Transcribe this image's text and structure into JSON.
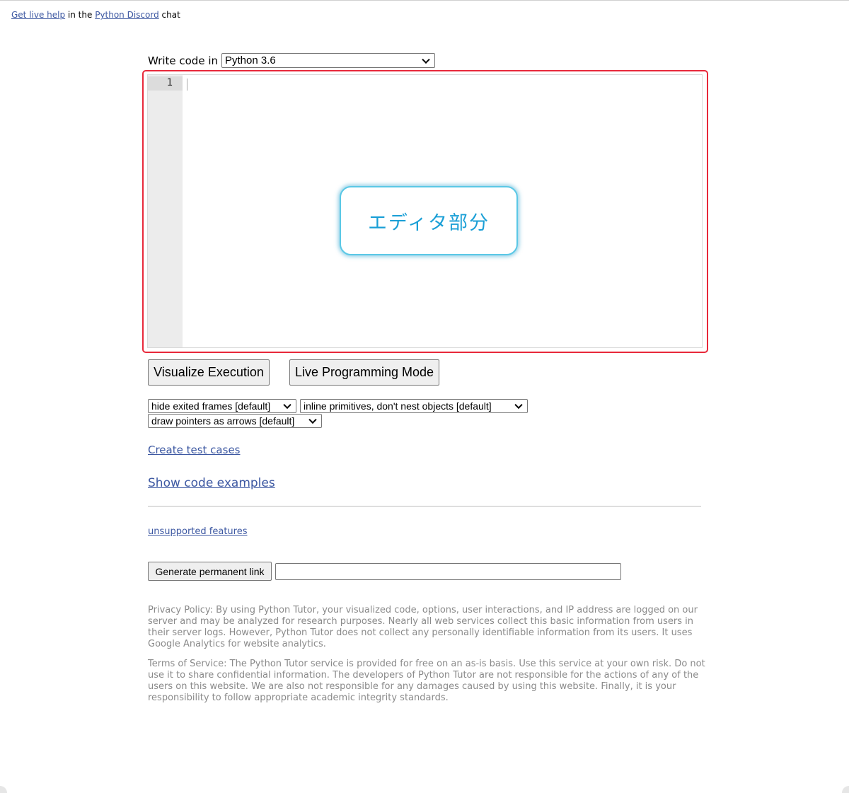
{
  "top_help": {
    "link1": "Get live help",
    "text1": " in the ",
    "link2": "Python Discord",
    "text2": " chat"
  },
  "editor_header": {
    "label": "Write code in",
    "language_selected": "Python 3.6"
  },
  "editor": {
    "line_numbers": [
      "1"
    ],
    "code": ""
  },
  "callout": {
    "text": "エディタ部分",
    "color": "#1a9fd6",
    "border_color": "#5bc8e6"
  },
  "highlight_color": "#e8283a",
  "buttons": {
    "visualize": "Visualize Execution",
    "live_mode": "Live Programming Mode",
    "permalink": "Generate permanent link"
  },
  "options": {
    "frames": "hide exited frames [default]",
    "primitives": "inline primitives, don't nest objects [default]",
    "pointers": "draw pointers as arrows [default]"
  },
  "links": {
    "test_cases": "Create test cases",
    "examples": "Show code examples",
    "unsupported": "unsupported features",
    "color": "#3d58a2"
  },
  "permalink_value": "",
  "legal": {
    "privacy": "Privacy Policy: By using Python Tutor, your visualized code, options, user interactions, and IP address are logged on our server and may be analyzed for research purposes. Nearly all web services collect this basic information from users in their server logs. However, Python Tutor does not collect any personally identifiable information from its users. It uses Google Analytics for website analytics.",
    "terms": "Terms of Service: The Python Tutor service is provided for free on an as-is basis. Use this service at your own risk. Do not use it to share confidential information. The developers of Python Tutor are not responsible for the actions of any of the users on this website. We are also not responsible for any damages caused by using this website. Finally, it is your responsibility to follow appropriate academic integrity standards."
  }
}
